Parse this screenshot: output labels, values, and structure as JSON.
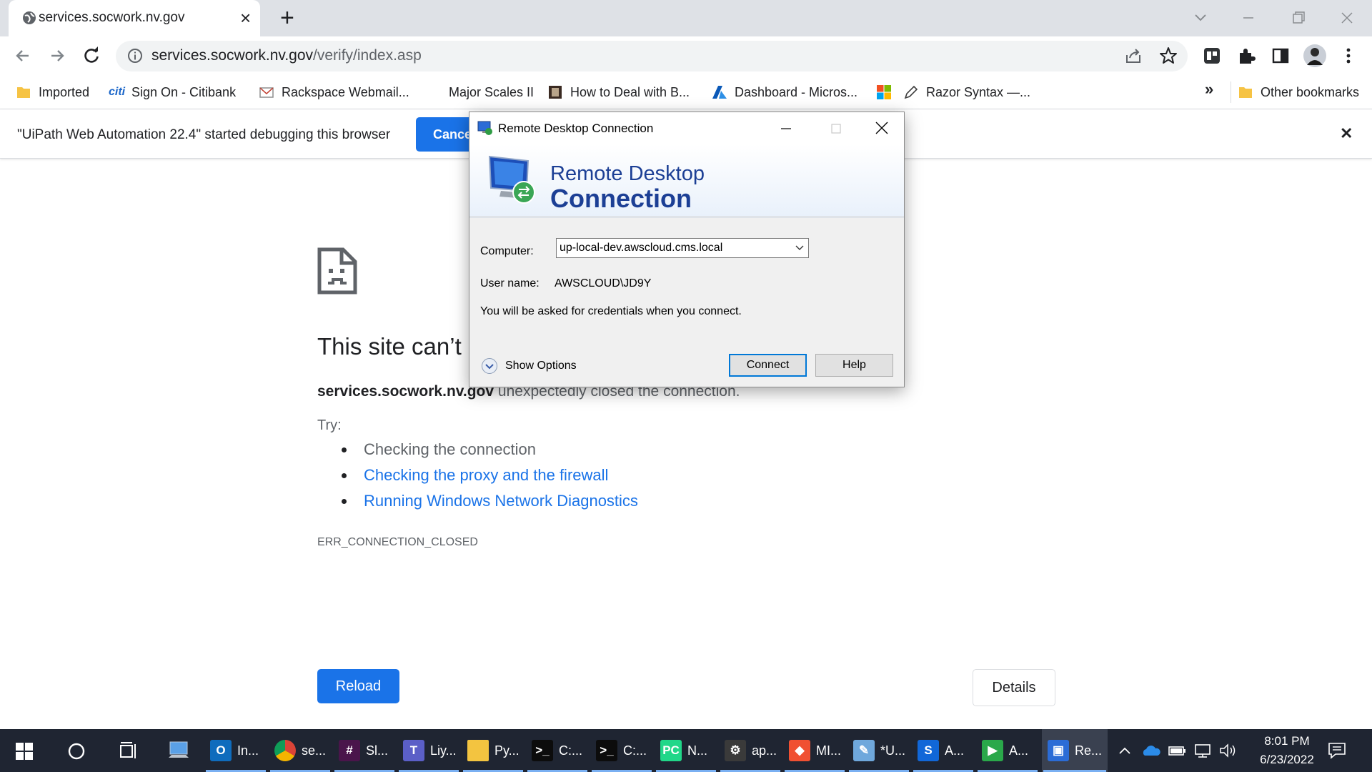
{
  "browser": {
    "tab": {
      "title": "services.socwork.nv.gov",
      "close_glyph": "×"
    },
    "new_tab_glyph": "+",
    "address": {
      "host": "services.socwork.nv.gov",
      "path": "/verify/index.asp"
    },
    "bookmarks": [
      {
        "label": "Imported",
        "icon": "folder-icon"
      },
      {
        "label": "Sign On - Citibank",
        "icon": "citi-icon"
      },
      {
        "label": "Rackspace Webmail...",
        "icon": "mail-icon"
      },
      {
        "label": "Major Scales II",
        "icon": "none"
      },
      {
        "label": "How to Deal with B...",
        "icon": "book-icon"
      },
      {
        "label": "Dashboard - Micros...",
        "icon": "azure-icon"
      },
      {
        "label": "",
        "icon": "microsoft-icon"
      },
      {
        "label": "Razor Syntax —...",
        "icon": "pen-icon"
      }
    ],
    "bookmarks_overflow": "»",
    "other_bookmarks": "Other bookmarks",
    "infobar": {
      "text": "\"UiPath Web Automation 22.4\" started debugging this browser",
      "cancel_label": "Cancel",
      "close_glyph": "✕"
    }
  },
  "error_page": {
    "title": "This site can’t be reached",
    "host": "services.socwork.nv.gov",
    "message": "unexpectedly closed the connection.",
    "try_label": "Try:",
    "suggestions": [
      {
        "text": "Checking the connection",
        "link": false
      },
      {
        "text": "Checking the proxy and the firewall",
        "link": true
      },
      {
        "text": "Running Windows Network Diagnostics",
        "link": true
      }
    ],
    "code": "ERR_CONNECTION_CLOSED",
    "reload_label": "Reload",
    "details_label": "Details"
  },
  "rdp_dialog": {
    "title": "Remote Desktop Connection",
    "banner_line1": "Remote Desktop",
    "banner_line2": "Connection",
    "computer_label": "Computer:",
    "computer_value": "up-local-dev.awscloud.cms.local",
    "username_label": "User name:",
    "username_value": "AWSCLOUD\\JD9Y",
    "notice": "You will be asked for credentials when you connect.",
    "show_options": "Show Options",
    "connect_label": "Connect",
    "help_label": "Help"
  },
  "taskbar": {
    "apps": [
      {
        "label": "In...",
        "icon": "outlook-icon",
        "color": "#0f6cbd",
        "glyph": "O"
      },
      {
        "label": "se...",
        "icon": "chrome-icon",
        "color": "#db4437",
        "glyph": ""
      },
      {
        "label": "Sl...",
        "icon": "slack-icon",
        "color": "#4a154b",
        "glyph": "#"
      },
      {
        "label": "Liy...",
        "icon": "teams-icon",
        "color": "#5b5fc7",
        "glyph": "T"
      },
      {
        "label": "Py...",
        "icon": "folder-icon",
        "color": "#f3c440",
        "glyph": ""
      },
      {
        "label": "C:...",
        "icon": "cmd-icon",
        "color": "#0c0c0c",
        "glyph": ">_"
      },
      {
        "label": "C:...",
        "icon": "cmd-icon",
        "color": "#0c0c0c",
        "glyph": ">_"
      },
      {
        "label": "N...",
        "icon": "pycharm-icon",
        "color": "#21d789",
        "glyph": "PC"
      },
      {
        "label": "ap...",
        "icon": "gear-icon",
        "color": "#3a3a3a",
        "glyph": "⚙"
      },
      {
        "label": "MI...",
        "icon": "git-icon",
        "color": "#f05032",
        "glyph": "◆"
      },
      {
        "label": "*U...",
        "icon": "notepad-icon",
        "color": "#6fa8dc",
        "glyph": "✎"
      },
      {
        "label": "A...",
        "icon": "s-app-icon",
        "color": "#1167d8",
        "glyph": "S"
      },
      {
        "label": "A...",
        "icon": "media-icon",
        "color": "#2aa84a",
        "glyph": "▶"
      },
      {
        "label": "Re...",
        "icon": "remote-desktop-icon",
        "color": "#2b6cd6",
        "glyph": "▣"
      }
    ],
    "time": "8:01 PM",
    "date": "6/23/2022"
  }
}
